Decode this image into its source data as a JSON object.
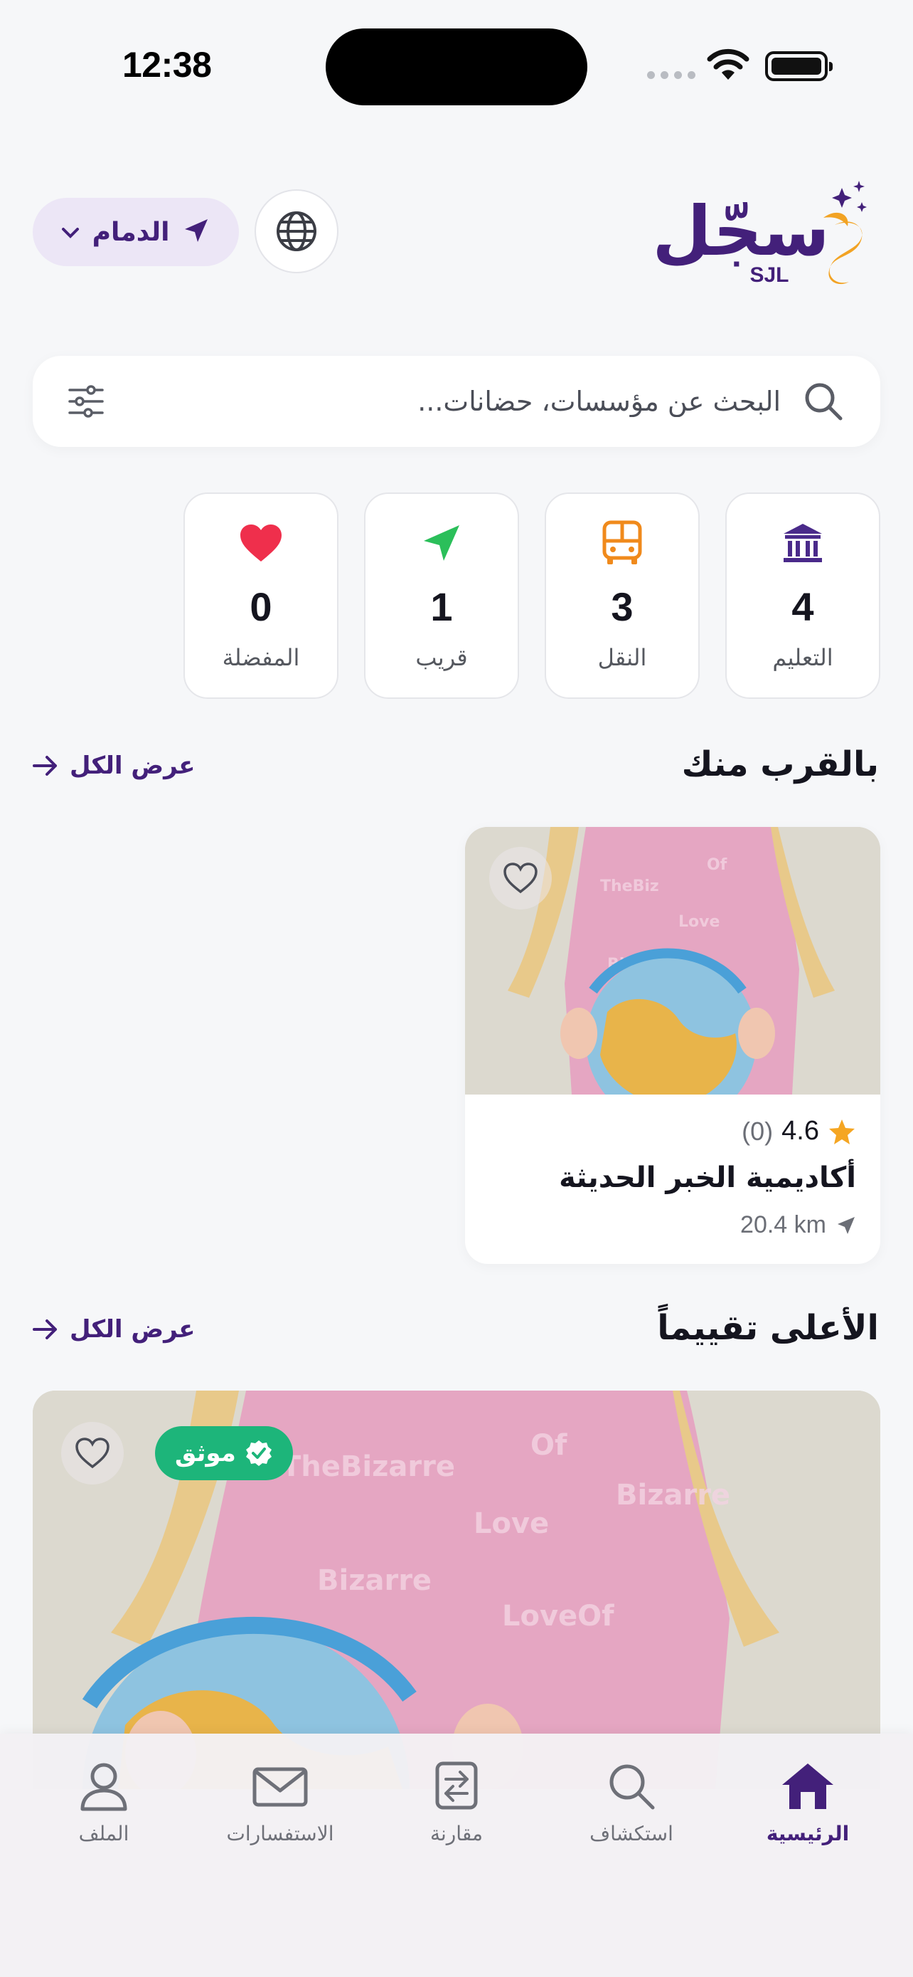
{
  "status_bar": {
    "time": "12:38"
  },
  "header": {
    "logo_text": "سجّل",
    "logo_sub": "SJL",
    "location": "الدمام"
  },
  "search": {
    "placeholder": "البحث عن مؤسسات، حضانات..."
  },
  "stats": [
    {
      "value": "4",
      "label": "التعليم",
      "icon": "institution-icon",
      "color": "#4a2a8a"
    },
    {
      "value": "3",
      "label": "النقل",
      "icon": "bus-icon",
      "color": "#f08a1c"
    },
    {
      "value": "1",
      "label": "قريب",
      "icon": "navigation-arrow-icon",
      "color": "#2bbf5a"
    },
    {
      "value": "0",
      "label": "المفضلة",
      "icon": "heart-icon",
      "color": "#ef2f4c"
    }
  ],
  "nearby": {
    "title": "بالقرب منك",
    "see_all": "عرض الكل",
    "card": {
      "rating": "4.6",
      "review_count": "(0)",
      "name": "أكاديمية الخبر الحديثة",
      "distance": "20.4 km"
    }
  },
  "top_rated": {
    "title": "الأعلى تقييماً",
    "see_all": "عرض الكل",
    "badge": "موثق"
  },
  "tabbar": [
    {
      "label": "الرئيسية",
      "icon": "home-icon",
      "active": true
    },
    {
      "label": "استكشاف",
      "icon": "search-icon",
      "active": false
    },
    {
      "label": "مقارنة",
      "icon": "compare-icon",
      "active": false
    },
    {
      "label": "الاستفسارات",
      "icon": "mail-icon",
      "active": false
    },
    {
      "label": "الملف",
      "icon": "profile-icon",
      "active": false
    }
  ],
  "colors": {
    "brand": "#43207a",
    "accent": "#f2a324",
    "verified": "#1db57a",
    "star": "#f5a623"
  }
}
